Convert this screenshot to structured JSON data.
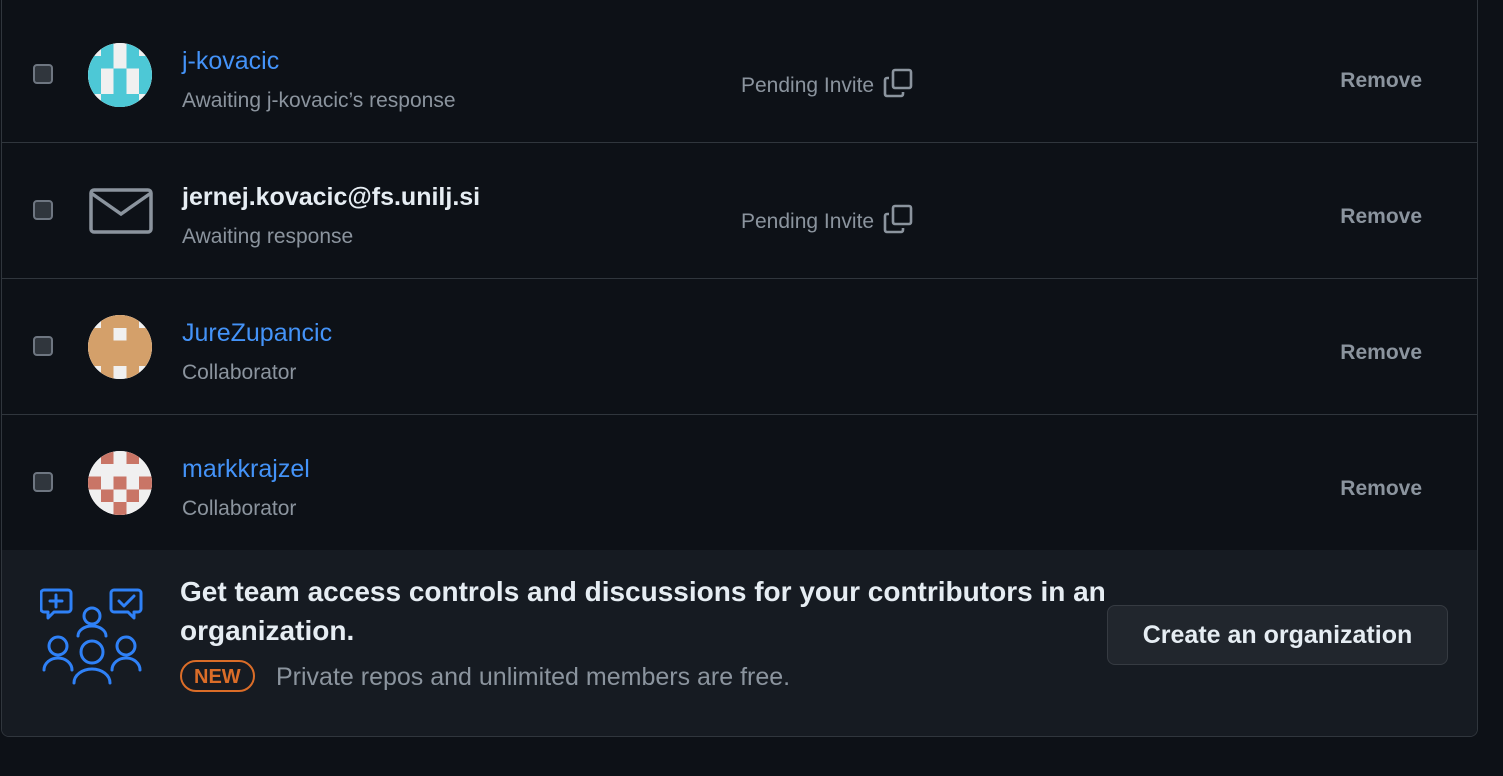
{
  "members": [
    {
      "name": "j-kovacic",
      "subtitle": "Awaiting j-kovacic’s response",
      "status": "Pending Invite",
      "action": "Remove",
      "avatar": "identicon-teal",
      "link": true
    },
    {
      "name": "jernej.kovacic@fs.unilj.si",
      "subtitle": "Awaiting response",
      "status": "Pending Invite",
      "action": "Remove",
      "avatar": "mail-icon",
      "link": false
    },
    {
      "name": "JureZupancic",
      "subtitle": "Collaborator",
      "status": "",
      "action": "Remove",
      "avatar": "identicon-tan",
      "link": true
    },
    {
      "name": "markkrajzel",
      "subtitle": "Collaborator",
      "status": "",
      "action": "Remove",
      "avatar": "identicon-red",
      "link": true
    }
  ],
  "promo": {
    "title": "Get team access controls and discussions for your contributors in an organization.",
    "badge": "NEW",
    "note": "Private repos and unlimited members are free.",
    "button": "Create an organization",
    "icon": "team-discussion-icon"
  },
  "colors": {
    "link": "#4493f8",
    "muted": "#8b949e",
    "badge": "#db6d28",
    "teal": "#4dc8d6",
    "tan": "#d4a06a",
    "red": "#c97566",
    "icon_blue": "#2f81f7"
  }
}
